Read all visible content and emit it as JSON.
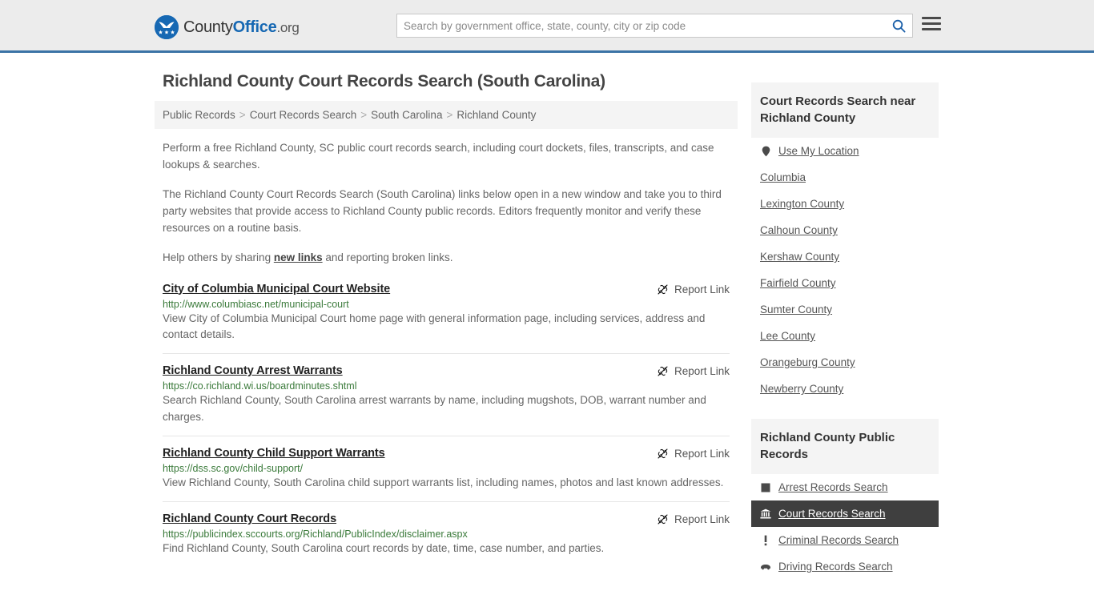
{
  "header": {
    "logo": {
      "icon": "eagle-shield-icon",
      "text_part1": "County",
      "text_part2": "Office",
      "text_part3": ".org"
    },
    "search": {
      "placeholder": "Search by government office, state, county, city or zip code",
      "value": "",
      "search_icon": "search-icon"
    },
    "menu_icon": "hamburger-menu-icon",
    "accent_color": "#3b73a6",
    "background_color": "#ececec"
  },
  "page": {
    "title": "Richland County Court Records Search (South Carolina)"
  },
  "breadcrumb": {
    "separator": ">",
    "items": [
      {
        "label": "Public Records"
      },
      {
        "label": "Court Records Search"
      },
      {
        "label": "South Carolina"
      },
      {
        "label": "Richland County"
      }
    ]
  },
  "intro": {
    "p1": "Perform a free Richland County, SC public court records search, including court dockets, files, transcripts, and case lookups & searches.",
    "p2": "The Richland County Court Records Search (South Carolina) links below open in a new window and take you to third party websites that provide access to Richland County public records. Editors frequently monitor and verify these resources on a routine basis.",
    "p3_before": "Help others by sharing ",
    "p3_link": "new links",
    "p3_after": " and reporting broken links."
  },
  "results": {
    "report_label": "Report Link",
    "report_icon": "broken-link-icon",
    "items": [
      {
        "title": "City of Columbia Municipal Court Website",
        "url": "http://www.columbiasc.net/municipal-court",
        "description": "View City of Columbia Municipal Court home page with general information page, including services, address and contact details."
      },
      {
        "title": "Richland County Arrest Warrants",
        "url": "https://co.richland.wi.us/boardminutes.shtml",
        "description": "Search Richland County, South Carolina arrest warrants by name, including mugshots, DOB, warrant number and charges."
      },
      {
        "title": "Richland County Child Support Warrants",
        "url": "https://dss.sc.gov/child-support/",
        "description": "View Richland County, South Carolina child support warrants list, including names, photos and last known addresses."
      },
      {
        "title": "Richland County Court Records",
        "url": "https://publicindex.sccourts.org/Richland/PublicIndex/disclaimer.aspx",
        "description": "Find Richland County, South Carolina court records by date, time, case number, and parties."
      }
    ]
  },
  "sidebar": {
    "nearby": {
      "title": "Court Records Search near Richland County",
      "use_my_location": {
        "label": "Use My Location",
        "icon": "map-pin-icon"
      },
      "items": [
        {
          "label": "Columbia"
        },
        {
          "label": "Lexington County"
        },
        {
          "label": "Calhoun County"
        },
        {
          "label": "Kershaw County"
        },
        {
          "label": "Fairfield County"
        },
        {
          "label": "Sumter County"
        },
        {
          "label": "Lee County"
        },
        {
          "label": "Orangeburg County"
        },
        {
          "label": "Newberry County"
        }
      ]
    },
    "public_records": {
      "title": "Richland County Public Records",
      "items": [
        {
          "label": "Arrest Records Search",
          "icon": "fingerprint-icon",
          "active": false
        },
        {
          "label": "Court Records Search",
          "icon": "courthouse-icon",
          "active": true
        },
        {
          "label": "Criminal Records Search",
          "icon": "exclamation-icon",
          "active": false
        },
        {
          "label": "Driving Records Search",
          "icon": "car-icon",
          "active": false
        }
      ],
      "active_background": "#3f3f3f"
    }
  }
}
